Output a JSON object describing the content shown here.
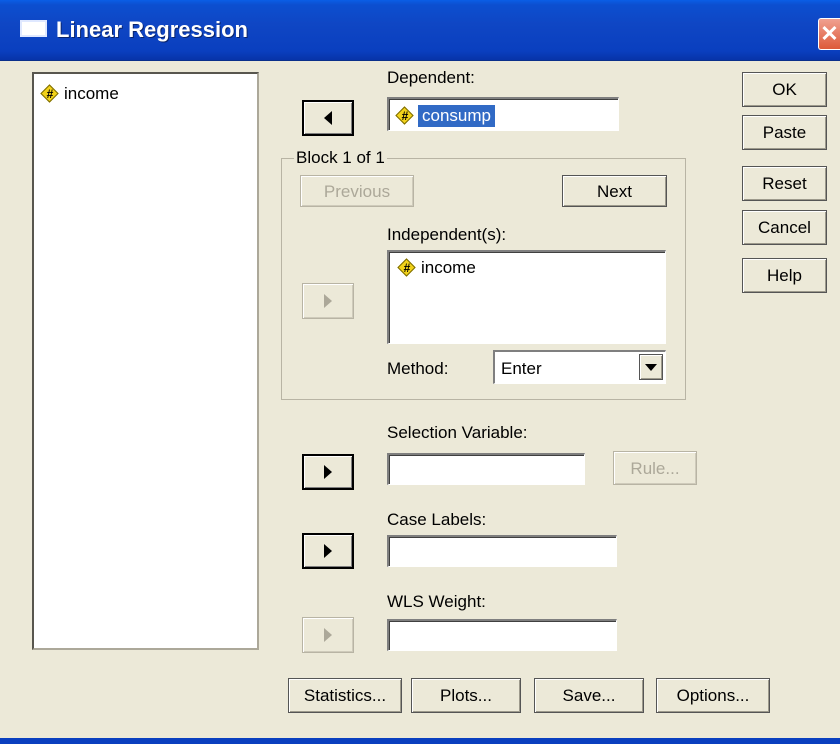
{
  "window": {
    "title": "Linear Regression",
    "close_glyph": "✕"
  },
  "source_list": {
    "items": [
      {
        "label": "income",
        "icon": "numeric-variable-icon"
      }
    ]
  },
  "dependent": {
    "label": "Dependent:",
    "value": "consump",
    "icon": "numeric-variable-icon"
  },
  "block": {
    "legend": "Block 1 of 1",
    "previous_label": "Previous",
    "next_label": "Next"
  },
  "independent": {
    "label": "Independent(s):",
    "items": [
      {
        "label": "income",
        "icon": "numeric-variable-icon"
      }
    ]
  },
  "method": {
    "label": "Method:",
    "value": "Enter"
  },
  "selection": {
    "label": "Selection Variable:",
    "value": "",
    "rule_label": "Rule..."
  },
  "case_labels": {
    "label": "Case Labels:",
    "value": ""
  },
  "wls": {
    "label": "WLS Weight:",
    "value": ""
  },
  "side_buttons": {
    "ok": "OK",
    "paste": "Paste",
    "reset": "Reset",
    "cancel": "Cancel",
    "help": "Help"
  },
  "bottom_buttons": {
    "statistics": "Statistics...",
    "plots": "Plots...",
    "save": "Save...",
    "options": "Options..."
  },
  "icon_glyph": "#",
  "colors": {
    "titlebar": "#0a3fbf",
    "selection": "#316ac5",
    "dialog_bg": "#ece9d8"
  }
}
